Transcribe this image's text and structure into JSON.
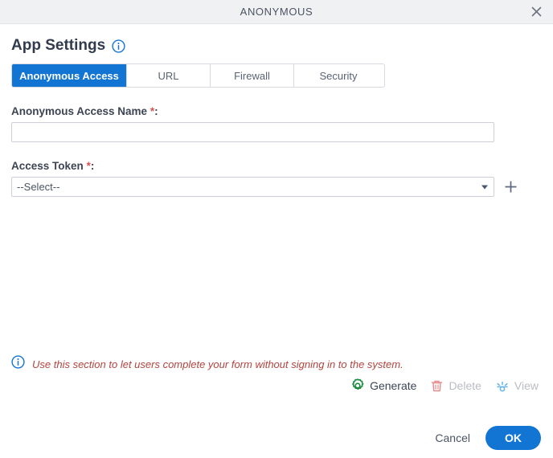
{
  "window": {
    "title": "ANONYMOUS",
    "close_icon": "close-icon"
  },
  "header": {
    "title": "App Settings",
    "info_icon": "info-circle-icon"
  },
  "tabs": [
    {
      "label": "Anonymous Access",
      "active": true
    },
    {
      "label": "URL",
      "active": false
    },
    {
      "label": "Firewall",
      "active": false
    },
    {
      "label": "Security",
      "active": false
    }
  ],
  "form": {
    "name_field": {
      "label": "Anonymous Access Name",
      "required_marker": "*",
      "colon": ":",
      "value": "",
      "placeholder": ""
    },
    "token_field": {
      "label": "Access Token",
      "required_marker": "*",
      "colon": ":",
      "selected": "--Select--",
      "options": [
        "--Select--"
      ],
      "add_icon": "plus-icon"
    }
  },
  "hint": {
    "icon": "info-circle-icon",
    "text": "Use this section to let users complete your form without signing in to the system."
  },
  "actions": [
    {
      "label": "Generate",
      "icon": "gear-icon",
      "enabled": true
    },
    {
      "label": "Delete",
      "icon": "trash-icon",
      "enabled": false
    },
    {
      "label": "View",
      "icon": "preview-eye-icon",
      "enabled": false
    }
  ],
  "footer": {
    "cancel_label": "Cancel",
    "ok_label": "OK"
  },
  "colors": {
    "accent": "#1275d4",
    "titlebar_bg": "#f0f1f3",
    "required": "#d9534f",
    "hint_text": "#b4443f",
    "generate_icon": "#1a8a3f",
    "delete_icon": "#e98b8b",
    "view_icon": "#6bb8e8",
    "disabled_text": "#b9bcc2"
  }
}
